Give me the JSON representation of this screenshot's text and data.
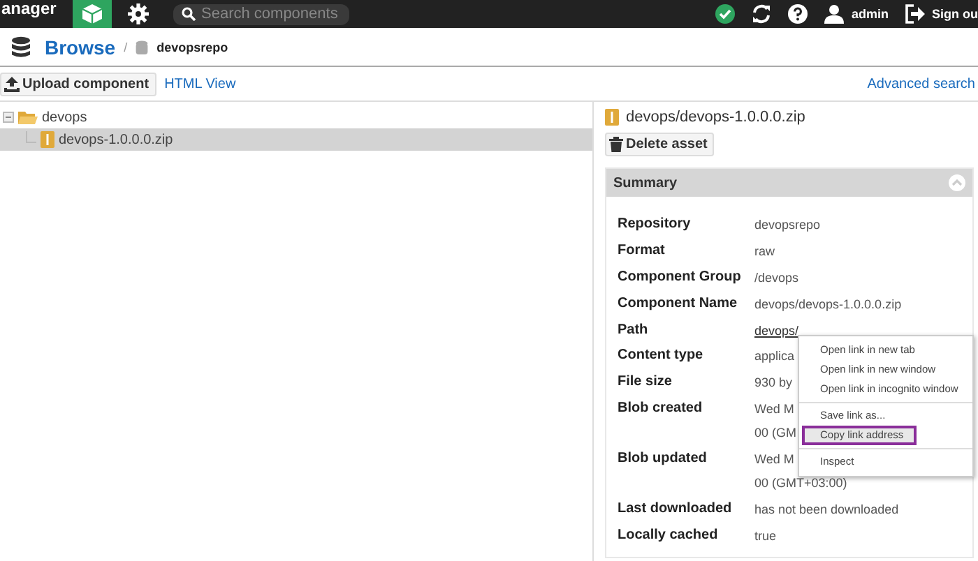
{
  "topbar": {
    "app_title": "anager",
    "search": {
      "placeholder": "Search components"
    },
    "user": "admin",
    "sign_out": "Sign ou"
  },
  "breadcrumb": {
    "title": "Browse",
    "separator": "/",
    "repository": "devopsrepo"
  },
  "toolbar": {
    "upload": "Upload component",
    "html_view": "HTML View",
    "advanced_search": "Advanced search"
  },
  "tree": [
    {
      "label": "devops",
      "kind": "folder",
      "selected": false,
      "expanded": true,
      "children": [
        {
          "label": "devops-1.0.0.0.zip",
          "kind": "asset",
          "selected": true
        }
      ]
    }
  ],
  "asset": {
    "title": "devops/devops-1.0.0.0.zip",
    "delete": "Delete asset",
    "summary": {
      "title": "Summary",
      "expanded": true,
      "rows": [
        {
          "label": "Repository",
          "value": [
            "devopsrepo"
          ]
        },
        {
          "label": "Format",
          "value": [
            "raw"
          ]
        },
        {
          "label": "Component Group",
          "value": [
            "/devops"
          ]
        },
        {
          "label": "Component Name",
          "value": [
            "devops/devops-1.0.0.0.zip"
          ]
        },
        {
          "label": "Path",
          "value": [
            "devops/"
          ],
          "kind": "link"
        },
        {
          "label": "Content type",
          "value": [
            "applica"
          ]
        },
        {
          "label": "File size",
          "value": [
            "930 by"
          ]
        },
        {
          "label": "Blob created",
          "value": [
            "Wed M",
            "00 (GM"
          ]
        },
        {
          "label": "Blob updated",
          "value": [
            "Wed M",
            "00 (GMT+03:00)"
          ]
        },
        {
          "label": "Last downloaded",
          "value": [
            "has not been downloaded"
          ]
        },
        {
          "label": "Locally cached",
          "value": [
            "true"
          ]
        }
      ]
    }
  },
  "context_menu": [
    {
      "label": "Open link in new tab",
      "selected": false
    },
    {
      "label": "Open link in new window",
      "selected": false
    },
    {
      "label": "Open link in incognito window",
      "selected": false,
      "separator_after": true
    },
    {
      "label": "Save link as...",
      "selected": false
    },
    {
      "label": "Copy link address",
      "selected": true,
      "separator_after": true
    },
    {
      "label": "Inspect",
      "selected": false
    }
  ]
}
